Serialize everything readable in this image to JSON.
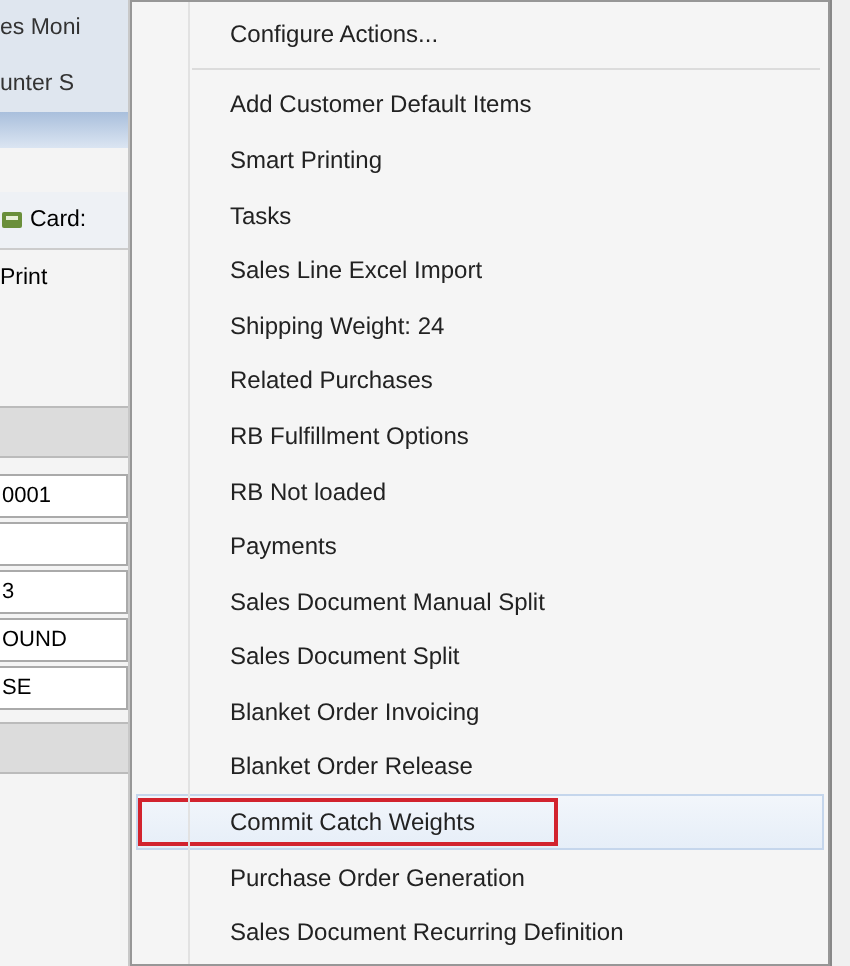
{
  "background_window": {
    "rows": [
      {
        "kind": "title",
        "text": "es Moni"
      },
      {
        "kind": "title",
        "text": "unter S"
      },
      {
        "kind": "bar"
      },
      {
        "kind": "gap"
      },
      {
        "kind": "toolbar",
        "text": "Card:"
      },
      {
        "kind": "label",
        "text": "Print"
      },
      {
        "kind": "gap"
      },
      {
        "kind": "header"
      },
      {
        "kind": "field",
        "text": "0001"
      },
      {
        "kind": "field",
        "text": ""
      },
      {
        "kind": "field",
        "text": "3"
      },
      {
        "kind": "field",
        "text": "OUND"
      },
      {
        "kind": "field",
        "text": "SE"
      },
      {
        "kind": "header"
      }
    ]
  },
  "context_menu": {
    "items": [
      {
        "label": "Configure Actions...",
        "separator_after": true,
        "selected": false
      },
      {
        "label": "Add Customer Default Items",
        "separator_after": false,
        "selected": false
      },
      {
        "label": "Smart Printing",
        "separator_after": false,
        "selected": false
      },
      {
        "label": "Tasks",
        "separator_after": false,
        "selected": false
      },
      {
        "label": "Sales Line Excel Import",
        "separator_after": false,
        "selected": false
      },
      {
        "label": "Shipping Weight: 24",
        "separator_after": false,
        "selected": false
      },
      {
        "label": "Related Purchases",
        "separator_after": false,
        "selected": false
      },
      {
        "label": "RB Fulfillment Options",
        "separator_after": false,
        "selected": false
      },
      {
        "label": "RB Not loaded",
        "separator_after": false,
        "selected": false
      },
      {
        "label": "Payments",
        "separator_after": false,
        "selected": false
      },
      {
        "label": "Sales Document Manual Split",
        "separator_after": false,
        "selected": false
      },
      {
        "label": "Sales Document Split",
        "separator_after": false,
        "selected": false
      },
      {
        "label": "Blanket Order Invoicing",
        "separator_after": false,
        "selected": false
      },
      {
        "label": "Blanket Order Release",
        "separator_after": false,
        "selected": false
      },
      {
        "label": "Commit Catch Weights",
        "separator_after": false,
        "selected": true
      },
      {
        "label": "Purchase Order Generation",
        "separator_after": false,
        "selected": false
      },
      {
        "label": "Sales Document Recurring Definition",
        "separator_after": false,
        "selected": false
      }
    ]
  }
}
